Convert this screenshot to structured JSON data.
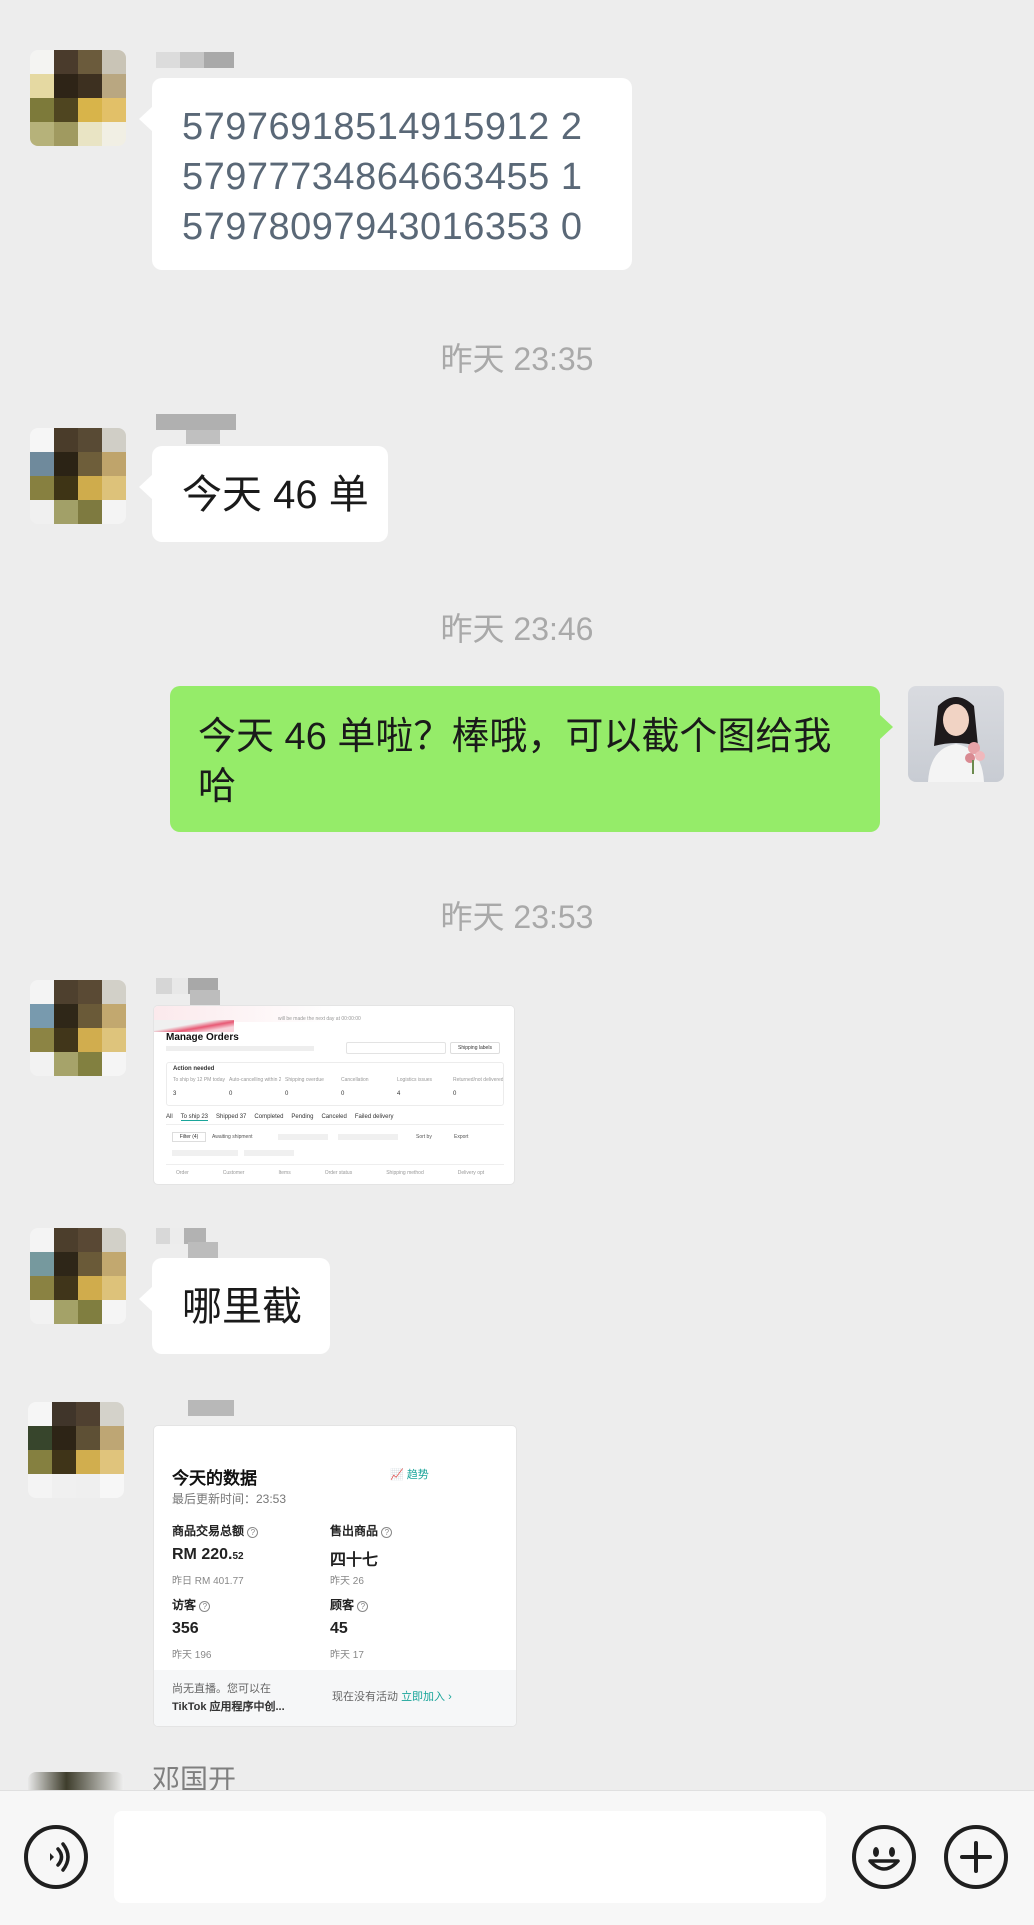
{
  "messages": {
    "m1": {
      "lines": [
        "57976918514915912 2",
        "57977734864663455 1",
        "57978097943016353 0"
      ]
    },
    "t1": "昨天 23:35",
    "m2": "今天 46 单",
    "t2": "昨天 23:46",
    "m3": {
      "line1": "今天 46 单啦？棒哦，可以截个图给我",
      "line2": "哈"
    },
    "t3": "昨天 23:53",
    "m5": "哪里截",
    "sender_name": "邓国开"
  },
  "shot1": {
    "banner": "will be made the next day at 00:00:00",
    "title": "Manage Orders",
    "shipping_button": "Shipping labels",
    "action_needed": "Action needed",
    "stats": [
      {
        "label": "To ship by 12 PM today",
        "value": "3"
      },
      {
        "label": "Auto-cancelling within 24 hours or less",
        "value": "0"
      },
      {
        "label": "Shipping overdue",
        "value": "0"
      },
      {
        "label": "Cancellation",
        "value": "0"
      },
      {
        "label": "Logistics issues",
        "value": "4"
      },
      {
        "label": "Returned/not delivered",
        "value": "0"
      }
    ],
    "tabs": [
      "All",
      "To ship 23",
      "Shipped 37",
      "Completed",
      "Pending",
      "Canceled",
      "Failed delivery"
    ],
    "filter": "Filter (4)",
    "awaiting": "Awaiting shipment",
    "sort": "Sort by",
    "export": "Export",
    "columns": [
      "Order",
      "Customer",
      "Items",
      "Order status",
      "Shipping method",
      "Delivery opt"
    ]
  },
  "shot2": {
    "title": "今天的数据",
    "trend": "趋势",
    "updated": "最后更新时间：23:53",
    "gmv_label": "商品交易总额",
    "gmv_value_main": "RM 220.",
    "gmv_value_dec": "52",
    "gmv_prev": "昨日 RM 401.77",
    "sold_label": "售出商品",
    "sold_value": "四十七",
    "sold_prev": "昨天 26",
    "visitors_label": "访客",
    "visitors_value": "356",
    "visitors_prev": "昨天 196",
    "customers_label": "顾客",
    "customers_value": "45",
    "customers_prev": "昨天 17",
    "live_line1": "尚无直播。您可以在",
    "live_line2": "TikTok 应用程序中创...",
    "activity_text": "现在没有活动",
    "join_link": "立即加入 ›"
  },
  "icons": [
    "voice-icon",
    "emoji-icon",
    "plus-icon"
  ],
  "colors": {
    "bg": "#ededed",
    "self_bubble": "#95ec69",
    "other_bubble": "#ffffff",
    "timestamp": "#a9a9a9",
    "link": "#1aa59a"
  }
}
